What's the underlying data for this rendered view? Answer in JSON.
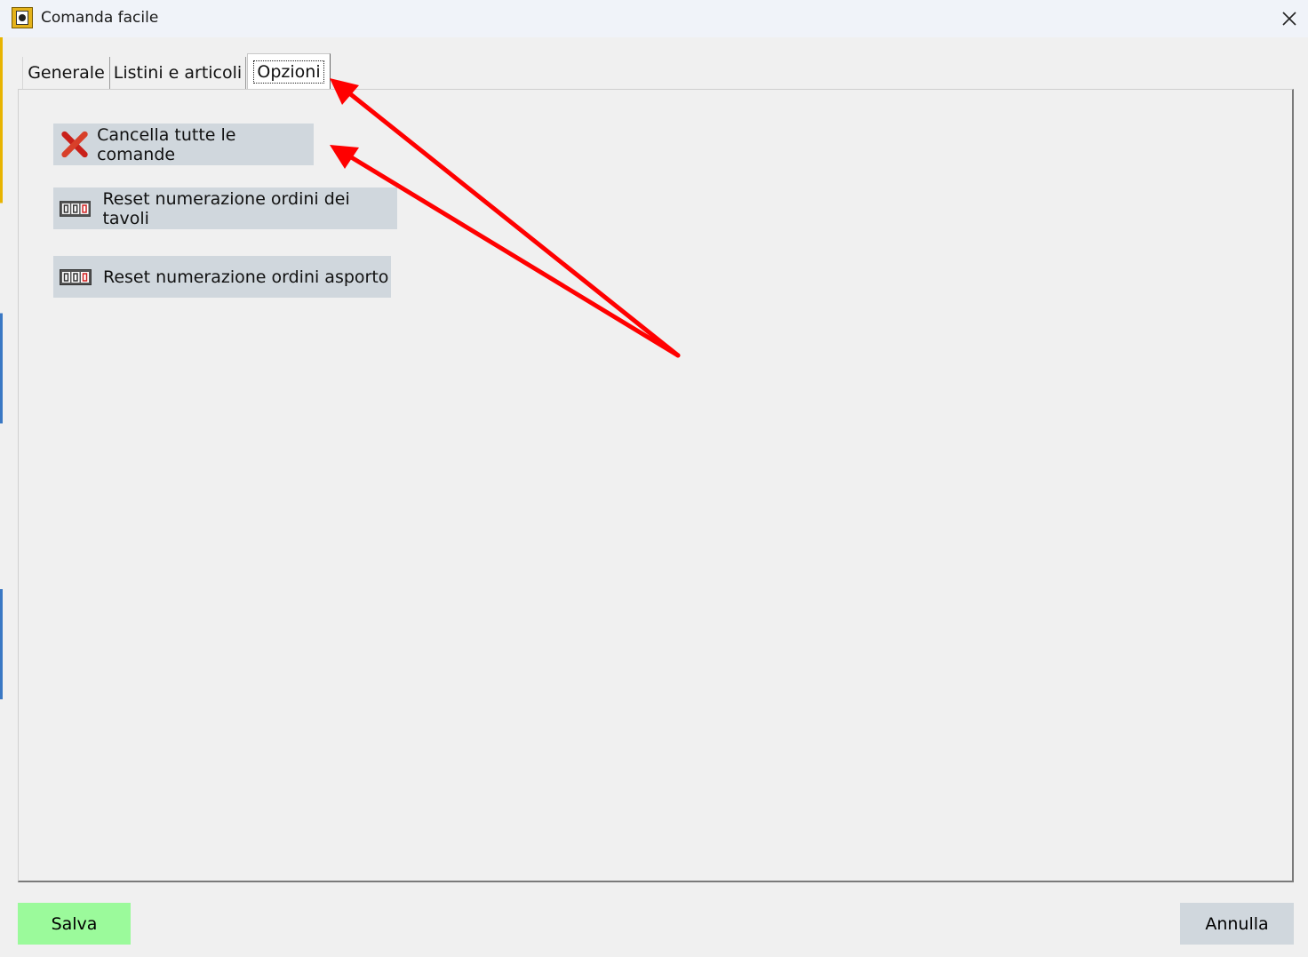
{
  "window": {
    "title": "Comanda facile",
    "app_icon": "app-logo-icon",
    "close_icon": "close-icon"
  },
  "tabs": [
    {
      "label": "Generale",
      "selected": false
    },
    {
      "label": "Listini e articoli",
      "selected": false
    },
    {
      "label": "Opzioni",
      "selected": true
    }
  ],
  "options": {
    "delete_all": {
      "label": "Cancella tutte le comande",
      "icon": "red-x-icon"
    },
    "reset_tables": {
      "label": "Reset numerazione ordini dei tavoli",
      "icon": "counter-icon"
    },
    "reset_takeaway": {
      "label": "Reset numerazione ordini asporto",
      "icon": "counter-icon"
    }
  },
  "footer": {
    "save_label": "Salva",
    "cancel_label": "Annulla"
  },
  "colors": {
    "save_button": "#9bfa9b",
    "option_button": "#d0d7dd",
    "annotation_arrow": "#ff0000"
  }
}
